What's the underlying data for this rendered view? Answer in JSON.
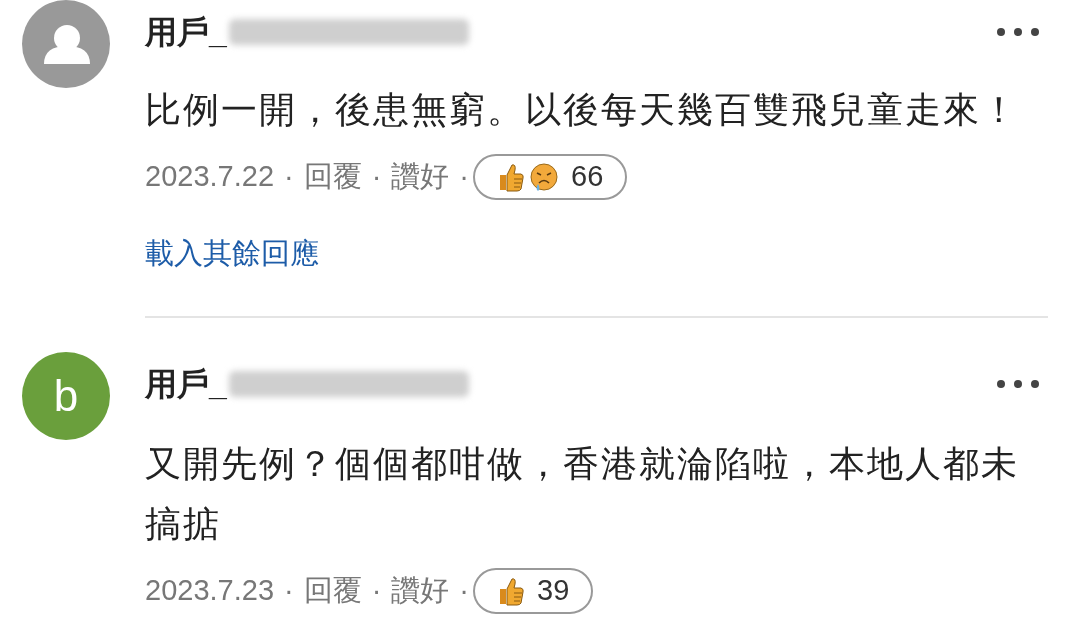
{
  "comments": [
    {
      "avatar": {
        "kind": "default"
      },
      "username": "用戶_",
      "text": "比例一開，後患無窮。以後每天幾百雙飛兒童走來！",
      "date": "2023.7.22",
      "reply": "回覆",
      "like": "讚好",
      "separator": "·",
      "reactions": [
        {
          "kind": "like"
        },
        {
          "kind": "sad"
        }
      ],
      "reaction_count": "66",
      "load_more": "載入其餘回應"
    },
    {
      "avatar": {
        "kind": "letter",
        "letter": "b",
        "color": "#6a9f3c"
      },
      "username": "用戶_",
      "text": "又開先例？個個都咁做，香港就淪陷啦，本地人都未搞掂",
      "date": "2023.7.23",
      "reply": "回覆",
      "like": "讚好",
      "separator": "·",
      "reactions": [
        {
          "kind": "like"
        }
      ],
      "reaction_count": "39"
    }
  ]
}
